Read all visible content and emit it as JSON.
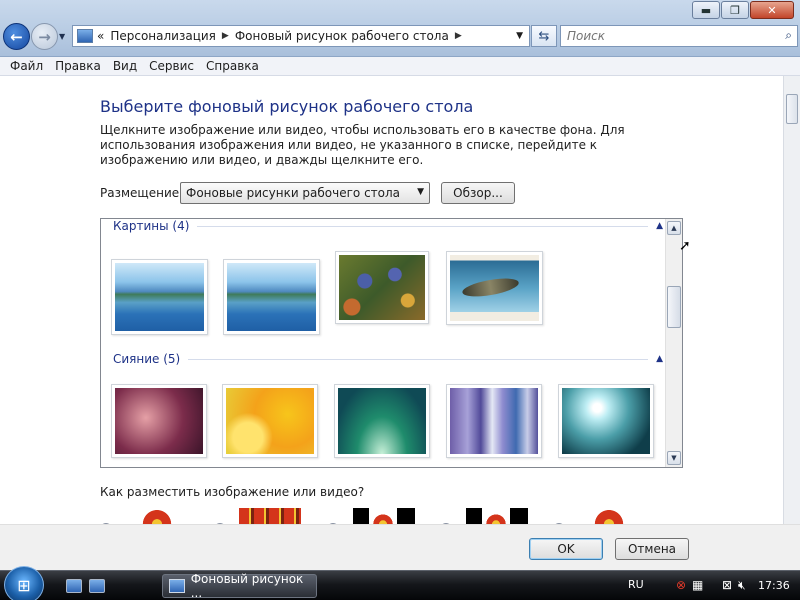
{
  "window": {
    "buttons": {
      "minimize": "▬",
      "maximize": "❐",
      "close": "✕"
    }
  },
  "nav": {
    "back_glyph": "←",
    "forward_glyph": "→",
    "breadcrumb_prefix": "«",
    "breadcrumb": [
      "Персонализация",
      "Фоновый рисунок рабочего стола"
    ],
    "search_placeholder": "Поиск"
  },
  "menu": [
    "Файл",
    "Правка",
    "Вид",
    "Сервис",
    "Справка"
  ],
  "page": {
    "title": "Выберите фоновый рисунок рабочего стола",
    "description": "Щелкните изображение или видео, чтобы использовать его в качестве фона. Для использования изображения или видео, не указанного в списке, перейдите к изображению или видео, и дважды щелкните его.",
    "placement_label": "Размещение",
    "placement_value": "Фоновые рисунки рабочего стола",
    "browse_label": "Обзор...",
    "position_question": "Как разместить изображение или видео?"
  },
  "gallery": {
    "groups": [
      {
        "title": "Картины (4)",
        "items": [
          "img-lake",
          "img-lake",
          "img-irises",
          "img-koi"
        ]
      },
      {
        "title": "Сияние (5)",
        "items": [
          "img-g1",
          "img-g2",
          "img-g3",
          "img-g4",
          "img-g5"
        ]
      }
    ]
  },
  "buttons": {
    "ok": "OK",
    "cancel": "Отмена"
  },
  "taskbar": {
    "task_label": "Фоновый рисунок ...",
    "language": "RU",
    "time": "17:36"
  },
  "colors": {
    "accent": "#1e3287",
    "taskbar": "#15171b"
  }
}
